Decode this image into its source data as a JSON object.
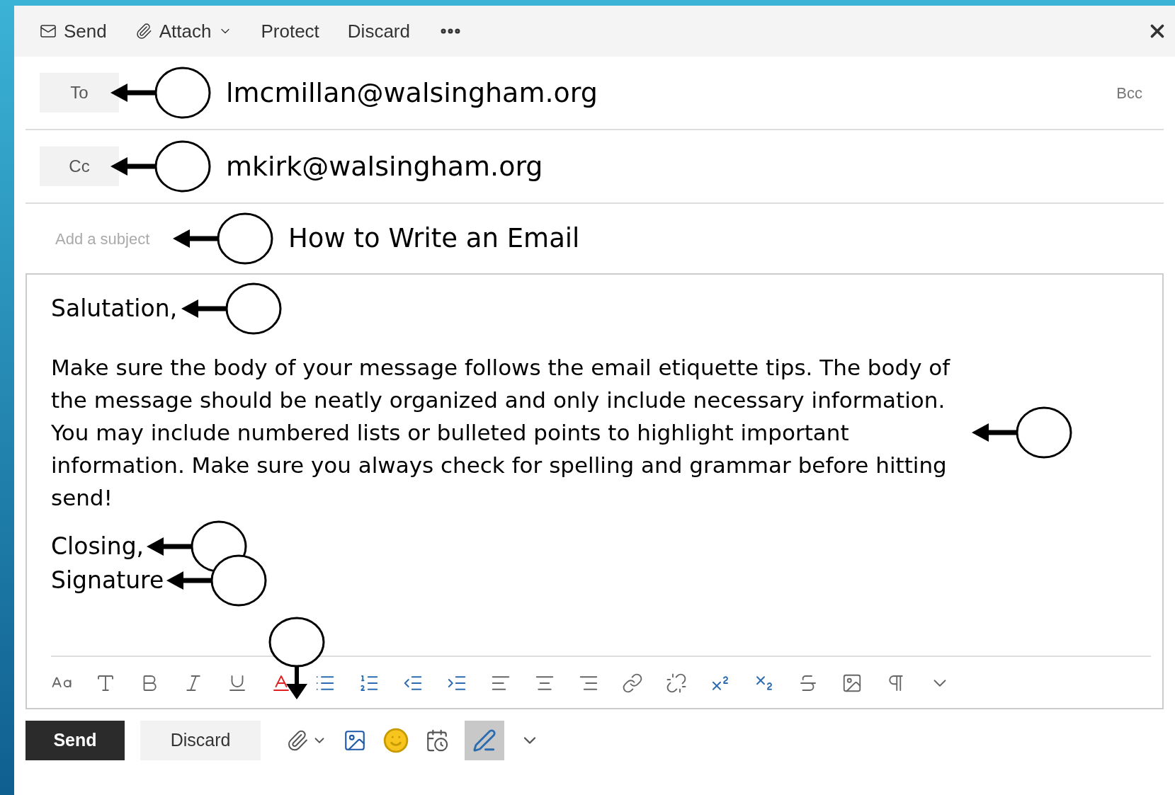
{
  "toolbar": [
    {
      "label": "Send"
    },
    {
      "label": "Attach"
    },
    {
      "label": "Protect"
    },
    {
      "label": "Discard"
    }
  ],
  "recipients": [
    {
      "button": "To",
      "value": "lmcmillan@walsingham.org"
    },
    {
      "button": "Cc",
      "value": "mkirk@walsingham.org"
    }
  ],
  "bcc": "Bcc",
  "subject": {
    "placeholder": "Add a subject",
    "value": "How to Write an Email"
  },
  "body": {
    "salutation": "Salutation,",
    "paragraph": "Make sure the body of your message follows the email etiquette tips. The body of the message should be neatly organized and only include necessary information. You may include numbered lists or bulleted points to highlight important information. Make sure you always check for spelling and grammar before hitting send!",
    "closing": "Closing,",
    "signature": "Signature"
  },
  "actions": [
    {
      "label": "Send",
      "primary": true
    },
    {
      "label": "Discard",
      "primary": false
    }
  ]
}
